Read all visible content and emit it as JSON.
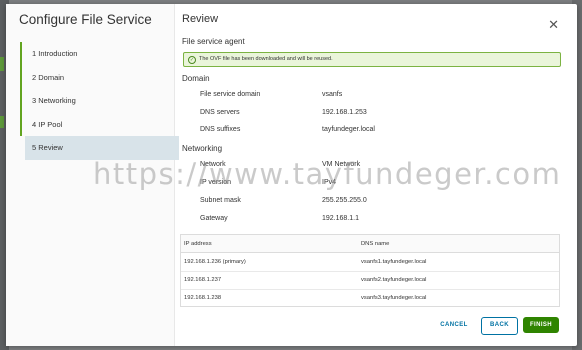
{
  "wizard": {
    "title": "Configure File Service",
    "steps": [
      {
        "label": "1  Introduction"
      },
      {
        "label": "2  Domain"
      },
      {
        "label": "3  Networking"
      },
      {
        "label": "4  IP Pool"
      },
      {
        "label": "5  Review"
      }
    ],
    "active_step": 5
  },
  "review": {
    "title": "Review",
    "agent_section": "File service agent",
    "agent_alert": "The OVF file has been downloaded and will be reused.",
    "domain_section": "Domain",
    "domain": {
      "file_service_domain_label": "File service domain",
      "file_service_domain_value": "vsanfs",
      "dns_servers_label": "DNS servers",
      "dns_servers_value": "192.168.1.253",
      "dns_suffixes_label": "DNS suffixes",
      "dns_suffixes_value": "tayfundeger.local"
    },
    "networking_section": "Networking",
    "networking": {
      "network_label": "Network",
      "network_value": "VM Network",
      "ip_version_label": "IP version",
      "ip_version_value": "IPv4",
      "subnet_mask_label": "Subnet mask",
      "subnet_mask_value": "255.255.255.0",
      "gateway_label": "Gateway",
      "gateway_value": "192.168.1.1"
    },
    "ip_table": {
      "headers": [
        "IP address",
        "DNS name"
      ],
      "rows": [
        [
          "192.168.1.236 (primary)",
          "vsanfs1.tayfundeger.local"
        ],
        [
          "192.168.1.237",
          "vsanfs2.tayfundeger.local"
        ],
        [
          "192.168.1.238",
          "vsanfs3.tayfundeger.local"
        ]
      ]
    }
  },
  "buttons": {
    "cancel": "CANCEL",
    "back": "BACK",
    "finish": "FINISH"
  },
  "watermark": "https://www.tayfundeger.com",
  "colors": {
    "accent": "#62a420",
    "link": "#0072a3",
    "finish": "#2f8400"
  }
}
